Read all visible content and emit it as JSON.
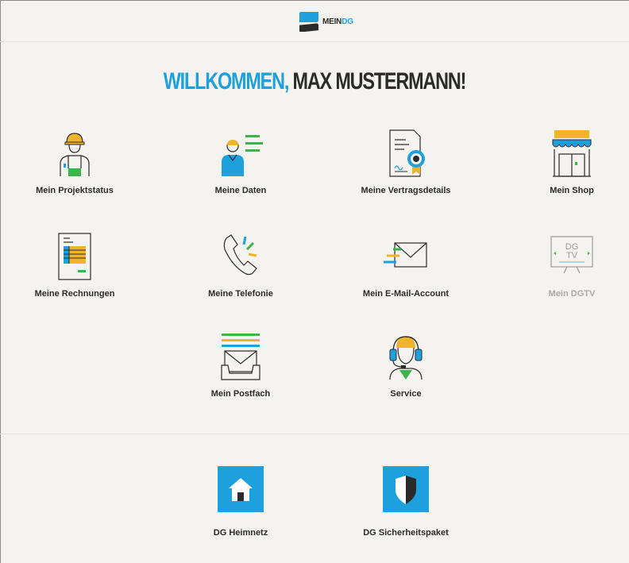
{
  "header": {
    "logo_mein": "MEIN",
    "logo_dg": "DG"
  },
  "welcome": {
    "prefix": "WILLKOMMEN,",
    "name": "MAX MUSTERMANN!"
  },
  "tiles": [
    {
      "label": "Mein Projektstatus",
      "icon": "construction-worker-icon"
    },
    {
      "label": "Meine Daten",
      "icon": "user-data-icon"
    },
    {
      "label": "Meine Vertragsdetails",
      "icon": "contract-certificate-icon"
    },
    {
      "label": "Mein Shop",
      "icon": "shop-icon"
    },
    {
      "label": "Meine Rechnungen",
      "icon": "invoice-icon"
    },
    {
      "label": "Meine Telefonie",
      "icon": "phone-icon"
    },
    {
      "label": "Mein E-Mail-Account",
      "icon": "email-icon"
    },
    {
      "label": "Mein DGTV",
      "icon": "tv-icon",
      "tv_text": "DG TV"
    },
    {
      "label": "Mein Postfach",
      "icon": "mailbox-icon"
    },
    {
      "label": "Service",
      "icon": "headset-service-icon"
    }
  ],
  "extras": [
    {
      "label": "DG Heimnetz",
      "icon": "home-network-icon"
    },
    {
      "label": "DG Sicherheitspaket",
      "icon": "security-shield-icon"
    }
  ],
  "colors": {
    "accent": "#1ea0dc",
    "green": "#3cb44b",
    "yellow": "#f0b428",
    "text": "#2b2b2b",
    "disabled": "#a9a9a9"
  }
}
